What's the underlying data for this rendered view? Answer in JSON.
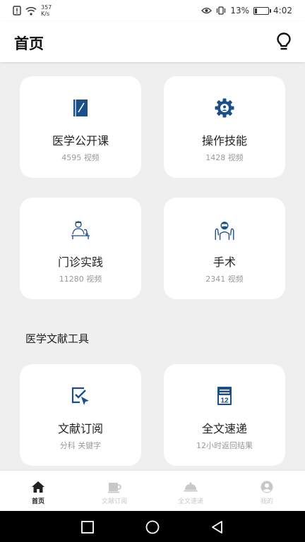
{
  "status": {
    "net_speed_value": "357",
    "net_speed_unit": "K/s",
    "battery": "13%",
    "time": "4:02"
  },
  "header": {
    "title": "首页",
    "action_icon": "lightbulb-icon"
  },
  "cards": [
    {
      "title": "医学公开课",
      "subtitle": "4595 视频",
      "icon": "book-icon"
    },
    {
      "title": "操作技能",
      "subtitle": "1428 视频",
      "icon": "gear-icon"
    },
    {
      "title": "门诊实践",
      "subtitle": "11280 视频",
      "icon": "doctor-icon"
    },
    {
      "title": "手术",
      "subtitle": "2341 视频",
      "icon": "surgeon-icon"
    }
  ],
  "tools_section": {
    "title": "医学文献工具",
    "cards": [
      {
        "title": "文献订阅",
        "subtitle": "分科 关键字",
        "icon": "subscribe-icon"
      },
      {
        "title": "全文速递",
        "subtitle": "12小时返回结果",
        "icon": "calendar-icon",
        "icon_text": "12"
      }
    ]
  },
  "tabbar": {
    "tabs": [
      {
        "label": "首页",
        "icon": "home-icon",
        "active": true
      },
      {
        "label": "文献订阅",
        "icon": "cup-icon",
        "active": false
      },
      {
        "label": "全文速递",
        "icon": "dish-cover-icon",
        "active": false
      },
      {
        "label": "我的",
        "icon": "user-icon",
        "active": false
      }
    ]
  },
  "colors": {
    "icon_blue": "#1a4f8a",
    "background": "#efefef",
    "inactive_tab": "#c8c8c8"
  }
}
